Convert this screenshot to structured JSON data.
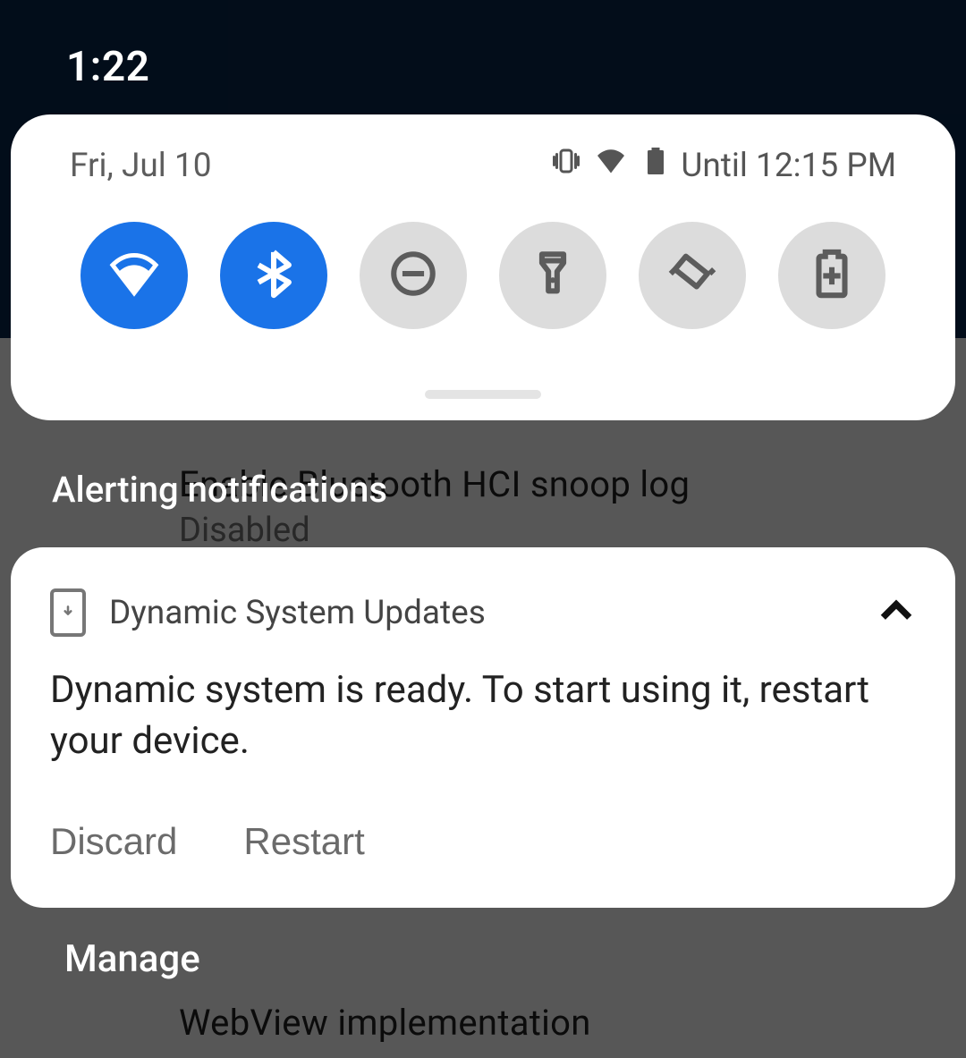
{
  "status_bar": {
    "time": "1:22"
  },
  "quick_settings": {
    "date": "Fri, Jul 10",
    "status_icons": [
      {
        "name": "vibrate-icon"
      },
      {
        "name": "wifi-icon"
      },
      {
        "name": "battery-icon"
      }
    ],
    "until_label": "Until 12:15 PM",
    "tiles": [
      {
        "name": "wifi-tile",
        "icon": "wifi-icon",
        "active": true
      },
      {
        "name": "bluetooth-tile",
        "icon": "bluetooth-icon",
        "active": true
      },
      {
        "name": "dnd-tile",
        "icon": "dnd-icon",
        "active": false
      },
      {
        "name": "flashlight-tile",
        "icon": "flashlight-icon",
        "active": false
      },
      {
        "name": "auto-rotate-tile",
        "icon": "auto-rotate-icon",
        "active": false
      },
      {
        "name": "battery-saver-tile",
        "icon": "battery-saver-icon",
        "active": false
      }
    ]
  },
  "section_header": "Alerting notifications",
  "notification": {
    "app_name": "Dynamic System Updates",
    "body": "Dynamic system is ready. To start using it, restart your device.",
    "actions": {
      "discard": "Discard",
      "restart": "Restart"
    }
  },
  "footer": {
    "manage": "Manage"
  },
  "background_settings": {
    "item1_title": "Enable Bluetooth HCI snoop log",
    "item1_sub": "Disabled",
    "item2_title": "WebView implementation"
  }
}
